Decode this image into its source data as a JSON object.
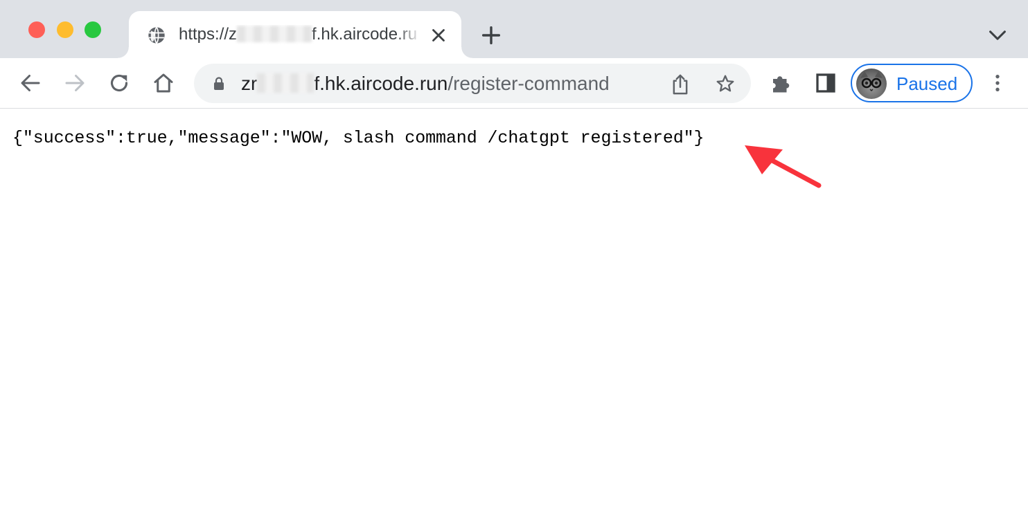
{
  "window": {
    "traffic_lights": {
      "close": "#fe5f57",
      "minimize": "#febc2e",
      "zoom": "#28c840"
    }
  },
  "tab": {
    "favicon": "globe-icon",
    "title_prefix": "https://z",
    "title_suffix": "f.hk.aircode.ru",
    "close_icon": "close-icon"
  },
  "tabstrip": {
    "new_tab_icon": "plus-icon",
    "tab_search_icon": "chevron-down-icon"
  },
  "toolbar": {
    "back_icon": "arrow-left-icon",
    "forward_icon": "arrow-right-icon",
    "reload_icon": "reload-icon",
    "home_icon": "home-icon",
    "omnibox": {
      "lock_icon": "lock-icon",
      "url_host_prefix": "zr",
      "url_host_suffix": "f.hk.aircode.run",
      "url_path": "/register-command",
      "share_icon": "share-icon",
      "bookmark_icon": "star-icon"
    },
    "extensions_icon": "puzzle-icon",
    "side_panel_icon": "side-panel-icon",
    "profile": {
      "label": "Paused",
      "accent": "#1a73e8"
    },
    "menu_icon": "kebab-menu-icon"
  },
  "content": {
    "response_text": "{\"success\":true,\"message\":\"WOW, slash command /chatgpt registered\"}",
    "annotation_arrow_color": "#f8333c"
  }
}
